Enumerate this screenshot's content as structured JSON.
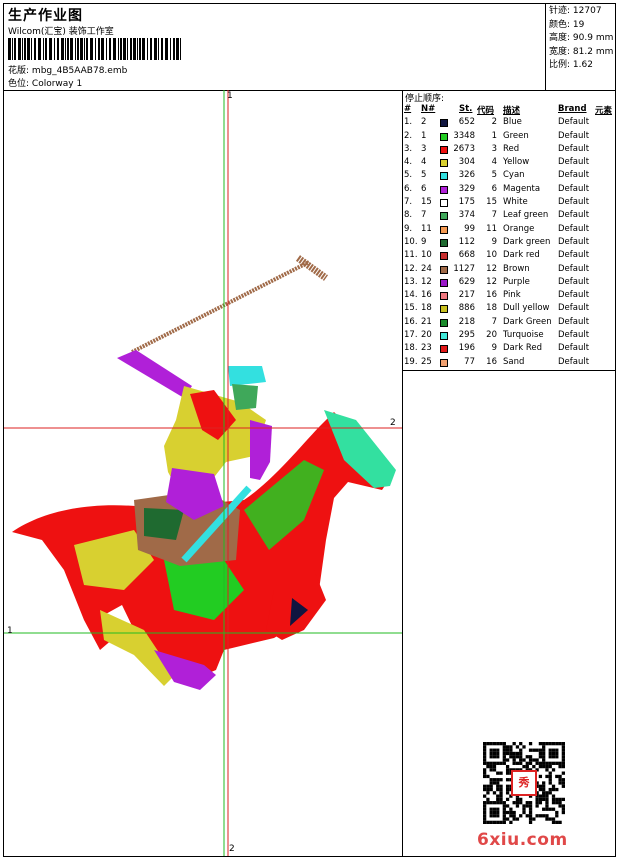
{
  "header": {
    "title": "生产作业图",
    "subtitle": "Wilcom(汇宝) 装饰工作室",
    "pattern_label": "花版:",
    "pattern_value": "mbg_4B5AAB78.emb",
    "colorway_label": "色位:",
    "colorway_value": "Colorway 1"
  },
  "stats": [
    {
      "label": "针迹:",
      "value": "12707"
    },
    {
      "label": "颜色:",
      "value": "19"
    },
    {
      "label": "高度:",
      "value": "90.9 mm"
    },
    {
      "label": "宽度:",
      "value": "81.2 mm"
    },
    {
      "label": "比例:",
      "value": "1.62"
    }
  ],
  "stop_sequence": {
    "title": "停止顺序:",
    "headers": {
      "no": "#",
      "n": "N#",
      "st": "St.",
      "code": "代码",
      "desc": "描述",
      "brand": "Brand",
      "element": "元素"
    },
    "rows": [
      {
        "no": "1.",
        "n": "2",
        "color": "#101540",
        "st": "652",
        "code": "2",
        "desc": "Blue",
        "brand": "Default"
      },
      {
        "no": "2.",
        "n": "1",
        "color": "#22cc22",
        "st": "3348",
        "code": "1",
        "desc": "Green",
        "brand": "Default"
      },
      {
        "no": "3.",
        "n": "3",
        "color": "#ee1111",
        "st": "2673",
        "code": "3",
        "desc": "Red",
        "brand": "Default"
      },
      {
        "no": "4.",
        "n": "4",
        "color": "#d8d030",
        "st": "304",
        "code": "4",
        "desc": "Yellow",
        "brand": "Default"
      },
      {
        "no": "5.",
        "n": "5",
        "color": "#33e0e0",
        "st": "326",
        "code": "5",
        "desc": "Cyan",
        "brand": "Default"
      },
      {
        "no": "6.",
        "n": "6",
        "color": "#b020d8",
        "st": "329",
        "code": "6",
        "desc": "Magenta",
        "brand": "Default"
      },
      {
        "no": "7.",
        "n": "15",
        "color": "#ffffff",
        "st": "175",
        "code": "15",
        "desc": "White",
        "brand": "Default"
      },
      {
        "no": "8.",
        "n": "7",
        "color": "#3fa85a",
        "st": "374",
        "code": "7",
        "desc": "Leaf green",
        "brand": "Default"
      },
      {
        "no": "9.",
        "n": "11",
        "color": "#f59a52",
        "st": "99",
        "code": "11",
        "desc": "Orange",
        "brand": "Default"
      },
      {
        "no": "10.",
        "n": "9",
        "color": "#1f6a30",
        "st": "112",
        "code": "9",
        "desc": "Dark green",
        "brand": "Default"
      },
      {
        "no": "11.",
        "n": "10",
        "color": "#c83030",
        "st": "668",
        "code": "10",
        "desc": "Dark red",
        "brand": "Default"
      },
      {
        "no": "12.",
        "n": "24",
        "color": "#a06a48",
        "st": "1127",
        "code": "12",
        "desc": "Brown",
        "brand": "Default"
      },
      {
        "no": "13.",
        "n": "12",
        "color": "#9a18c8",
        "st": "629",
        "code": "12",
        "desc": "Purple",
        "brand": "Default"
      },
      {
        "no": "14.",
        "n": "16",
        "color": "#f07880",
        "st": "217",
        "code": "16",
        "desc": "Pink",
        "brand": "Default"
      },
      {
        "no": "15.",
        "n": "18",
        "color": "#c8c020",
        "st": "886",
        "code": "18",
        "desc": "Dull yellow",
        "brand": "Default"
      },
      {
        "no": "16.",
        "n": "21",
        "color": "#1a8a2a",
        "st": "218",
        "code": "7",
        "desc": "Dark Green",
        "brand": "Default"
      },
      {
        "no": "17.",
        "n": "20",
        "color": "#40e8d8",
        "st": "295",
        "code": "20",
        "desc": "Turquoise",
        "brand": "Default"
      },
      {
        "no": "18.",
        "n": "23",
        "color": "#e01818",
        "st": "196",
        "code": "9",
        "desc": "Dark Red",
        "brand": "Default"
      },
      {
        "no": "19.",
        "n": "25",
        "color": "#f0a070",
        "st": "77",
        "code": "16",
        "desc": "Sand",
        "brand": "Default"
      }
    ]
  },
  "crosshair_labels": {
    "v_top": "1",
    "v_bottom": "2",
    "h_left": "1",
    "h_right": "2"
  },
  "watermark": "6xiu.com",
  "qr_stamp": "秀"
}
